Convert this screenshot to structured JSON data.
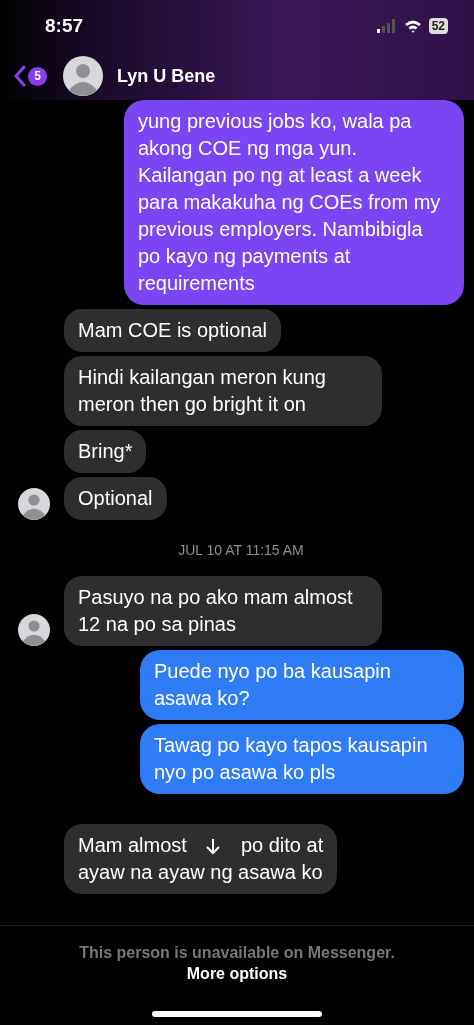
{
  "status_bar": {
    "time": "8:57",
    "battery": "52"
  },
  "header": {
    "back_count": "5",
    "name": "Lyn U Bene"
  },
  "messages": [
    {
      "kind": "outgoing",
      "color": "#7b45f3",
      "text": "yung previous jobs ko, wala pa akong COE ng mga yun. Kailangan po ng at least a week para makakuha ng COEs from my previous employers. Nambibigla po kayo ng payments at requirements"
    },
    {
      "kind": "incoming",
      "avatar": false,
      "text": "Mam COE is optional"
    },
    {
      "kind": "incoming",
      "avatar": false,
      "text": "Hindi kailangan meron kung meron then go bright it on"
    },
    {
      "kind": "incoming",
      "avatar": false,
      "text": "Bring*"
    },
    {
      "kind": "incoming",
      "avatar": true,
      "text": "Optional"
    },
    {
      "kind": "timestamp",
      "text": "JUL 10 AT 11:15 AM"
    },
    {
      "kind": "incoming",
      "avatar": true,
      "text": "Pasuyo na po ako mam almost 12 na po sa pinas"
    },
    {
      "kind": "outgoing",
      "color": "#2f7cf6",
      "text": "Puede nyo po ba kausapin asawa ko?"
    },
    {
      "kind": "outgoing",
      "color": "#2f7cf6",
      "text": "Tawag po kayo tapos kausapin nyo po asawa ko pls"
    },
    {
      "kind": "covered",
      "text": "Mam almost",
      "text_after": "po dito at",
      "text_line2": "ayaw na ayaw ng asawa ko"
    }
  ],
  "footer": {
    "notice": "This person is unavailable on Messenger.",
    "link": "More options"
  }
}
